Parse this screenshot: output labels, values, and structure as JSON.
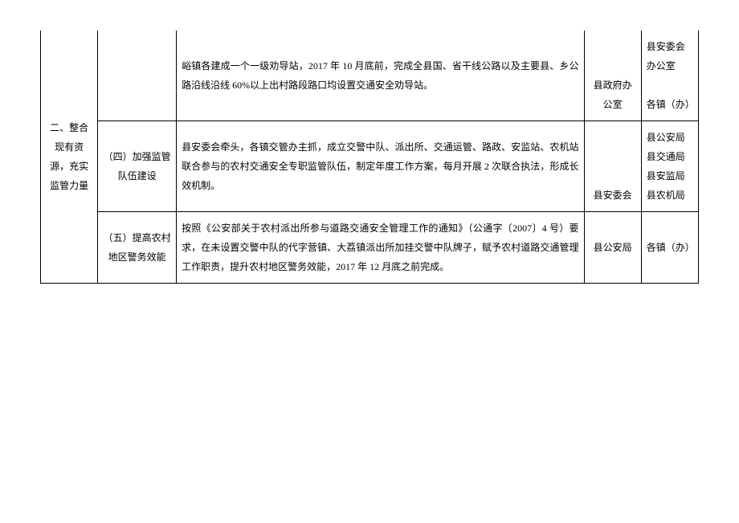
{
  "category": "二、整合现有资源，充实监管力量",
  "rows": [
    {
      "subtask": "",
      "desc": "峪镇各建成一个一级劝导站，2017 年 10 月底前，完成全县国、省干线公路以及主要县、乡公路沿线沿线 60%以上出村路段路口均设置交通安全劝导站。",
      "lead1": "县政府办公室",
      "coop": "县安委会办公室\n\n各镇（办）"
    },
    {
      "subtask": "（四）加强监管队伍建设",
      "desc": "县安委会牵头，各镇交管办主抓，成立交警中队、派出所、交通运管、路政、安监站、农机站联合参与的农村交通安全专职监管队伍，制定年度工作方案，每月开展 2 次联合执法，形成长效机制。",
      "lead2": "县安委会",
      "coop": "县公安局县交通局县安监局县农机局"
    },
    {
      "subtask": "（五）提高农村地区警务效能",
      "desc": "按照《公安部关于农村派出所参与道路交通安全管理工作的通知》（公通字〔2007〕4 号）要求，在未设置交警中队的代字营镇、大荔镇派出所加挂交警中队牌子，赋予农村道路交通管理工作职责，提升农村地区警务效能，2017 年 12 月底之前完成。",
      "lead2": "县公安局",
      "coop": "各镇（办）"
    }
  ]
}
